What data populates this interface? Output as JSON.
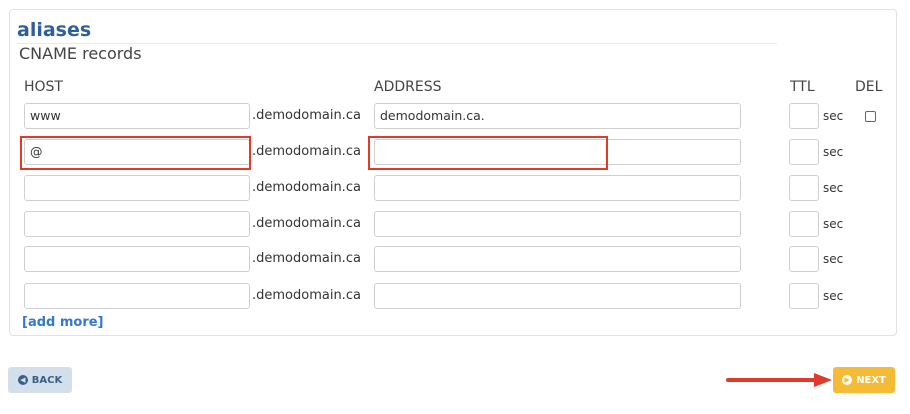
{
  "section": {
    "title": "aliases",
    "subtitle": "CNAME records"
  },
  "columns": {
    "host": "HOST",
    "address": "ADDRESS",
    "ttl": "TTL",
    "del": "DEL"
  },
  "domain_suffix": ".demodomain.ca",
  "ttl_unit": "sec",
  "rows": [
    {
      "host": "www",
      "address": "demodomain.ca.",
      "ttl": "",
      "has_delete": true
    },
    {
      "host": "@",
      "address": "",
      "ttl": "",
      "has_delete": false
    },
    {
      "host": "",
      "address": "",
      "ttl": "",
      "has_delete": false
    },
    {
      "host": "",
      "address": "",
      "ttl": "",
      "has_delete": false
    },
    {
      "host": "",
      "address": "",
      "ttl": "",
      "has_delete": false
    },
    {
      "host": "",
      "address": "",
      "ttl": "",
      "has_delete": false
    }
  ],
  "add_more_label": "[add more]",
  "buttons": {
    "back_label": "BACK",
    "next_label": "NEXT",
    "back_icon": "left-arrow-circle-icon",
    "next_icon": "right-arrow-circle-icon"
  },
  "colors": {
    "title": "#2d5f9a",
    "highlight": "#e03a2a",
    "next_button": "#f5bb34",
    "back_button": "#d3dfeb",
    "link": "#3579c8"
  }
}
